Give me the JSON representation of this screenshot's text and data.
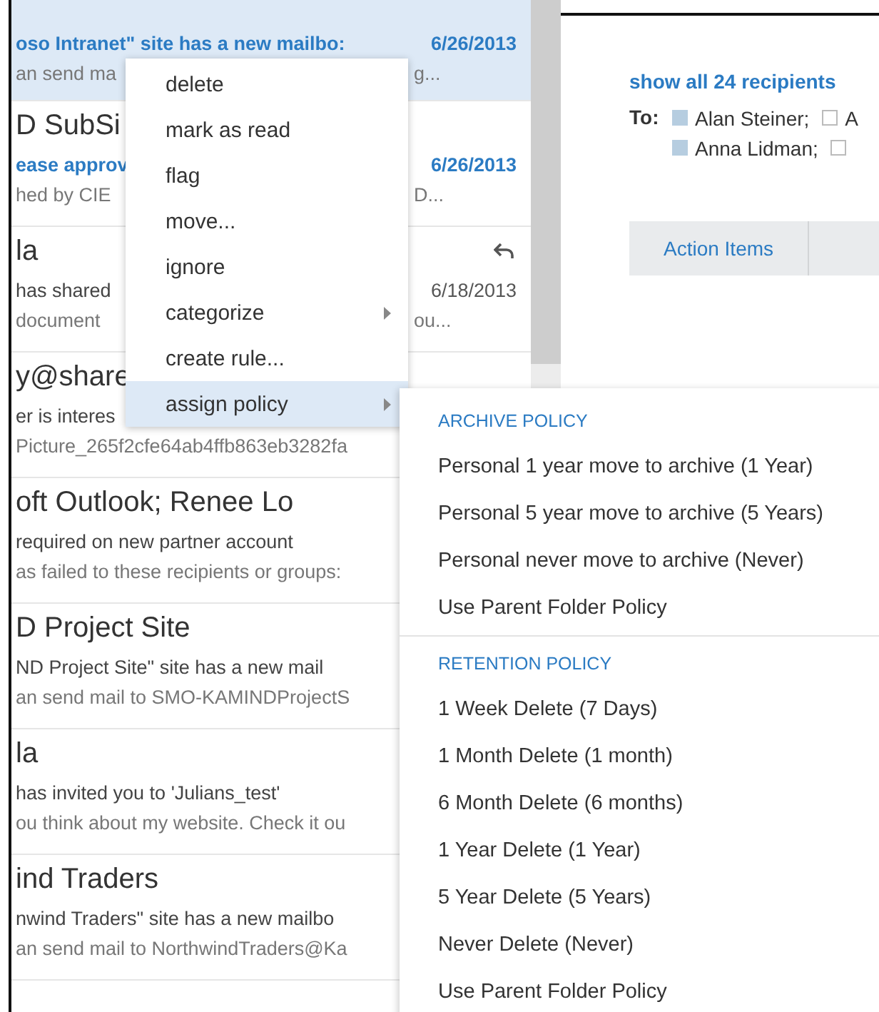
{
  "mail_list": {
    "messages": [
      {
        "subject": "oso Intranet\" site has a new mailbo:",
        "date": "6/26/2013",
        "preview": "an send ma",
        "preview_tail": "g...",
        "selected": true,
        "unread": true
      },
      {
        "title": "D SubSi",
        "subject": "ease approv",
        "date": "6/26/2013",
        "preview": "hed by CIE",
        "preview_tail": "D...",
        "selected": false,
        "unread": true,
        "replied": false
      },
      {
        "title": "la",
        "subject": "has shared",
        "date": "6/18/2013",
        "preview": "document",
        "preview_tail": "ou...",
        "selected": false,
        "unread": false,
        "replied": true
      },
      {
        "title": "y@share",
        "subject": "er is interes",
        "preview": "Picture_265f2cfe64ab4ffb863eb3282fa",
        "selected": false,
        "unread": false,
        "replied": false
      },
      {
        "title": "oft Outlook; Renee Lo",
        "subject": "required on new partner account",
        "preview": "as failed to these recipients or groups:",
        "selected": false,
        "unread": false,
        "replied": false
      },
      {
        "title": "D Project Site",
        "subject": "ND Project Site\" site has a new mail",
        "preview": "an send mail to SMO-KAMINDProjectS",
        "selected": false,
        "unread": false,
        "replied": false
      },
      {
        "title": "la",
        "subject": "has invited you to 'Julians_test'",
        "preview": "ou think about my website. Check it ou",
        "selected": false,
        "unread": false,
        "replied": false
      },
      {
        "title": "ind Traders",
        "subject": "nwind Traders\" site has a new mailbo",
        "preview": "an send mail to NorthwindTraders@Ka",
        "selected": false,
        "unread": false,
        "replied": false
      }
    ]
  },
  "reading_pane": {
    "recipients_link": "show all 24 recipients",
    "to_label": "To:",
    "recipient_lines": [
      [
        {
          "name": "Alan Steiner;",
          "marked": true
        },
        {
          "name": "A",
          "marked": false
        }
      ],
      [
        {
          "name": "Anna Lidman;",
          "marked": true
        },
        {
          "marked": false
        }
      ]
    ],
    "tabs": [
      {
        "label": "Action Items"
      }
    ]
  },
  "context_menu": {
    "items": [
      {
        "label": "delete",
        "selected": false,
        "has_submenu": false
      },
      {
        "label": "mark as read",
        "selected": false,
        "has_submenu": false
      },
      {
        "label": "flag",
        "selected": false,
        "has_submenu": false
      },
      {
        "label": "move...",
        "selected": false,
        "has_submenu": false
      },
      {
        "label": "ignore",
        "selected": false,
        "has_submenu": false
      },
      {
        "label": "categorize",
        "selected": false,
        "has_submenu": true
      },
      {
        "label": "create rule...",
        "selected": false,
        "has_submenu": false
      },
      {
        "label": "assign policy",
        "selected": true,
        "has_submenu": true
      }
    ]
  },
  "submenu": {
    "sections": [
      {
        "heading": "ARCHIVE POLICY",
        "items": [
          {
            "label": "Personal 1 year move to archive (1 Year)",
            "selected": false
          },
          {
            "label": "Personal 5 year move to archive (5 Years)",
            "selected": false
          },
          {
            "label": "Personal never move to archive (Never)",
            "selected": false
          },
          {
            "label": "Use Parent Folder Policy",
            "selected": false
          }
        ]
      },
      {
        "heading": "RETENTION POLICY",
        "items": [
          {
            "label": "1 Week Delete (7 Days)",
            "selected": false
          },
          {
            "label": "1 Month Delete (1 month)",
            "selected": false
          },
          {
            "label": "6 Month Delete (6 months)",
            "selected": false
          },
          {
            "label": "1 Year Delete (1 Year)",
            "selected": false
          },
          {
            "label": "5 Year Delete (5 Years)",
            "selected": false
          },
          {
            "label": "Never Delete (Never)",
            "selected": false
          },
          {
            "label": "Use Parent Folder Policy",
            "selected": false
          }
        ]
      }
    ]
  }
}
